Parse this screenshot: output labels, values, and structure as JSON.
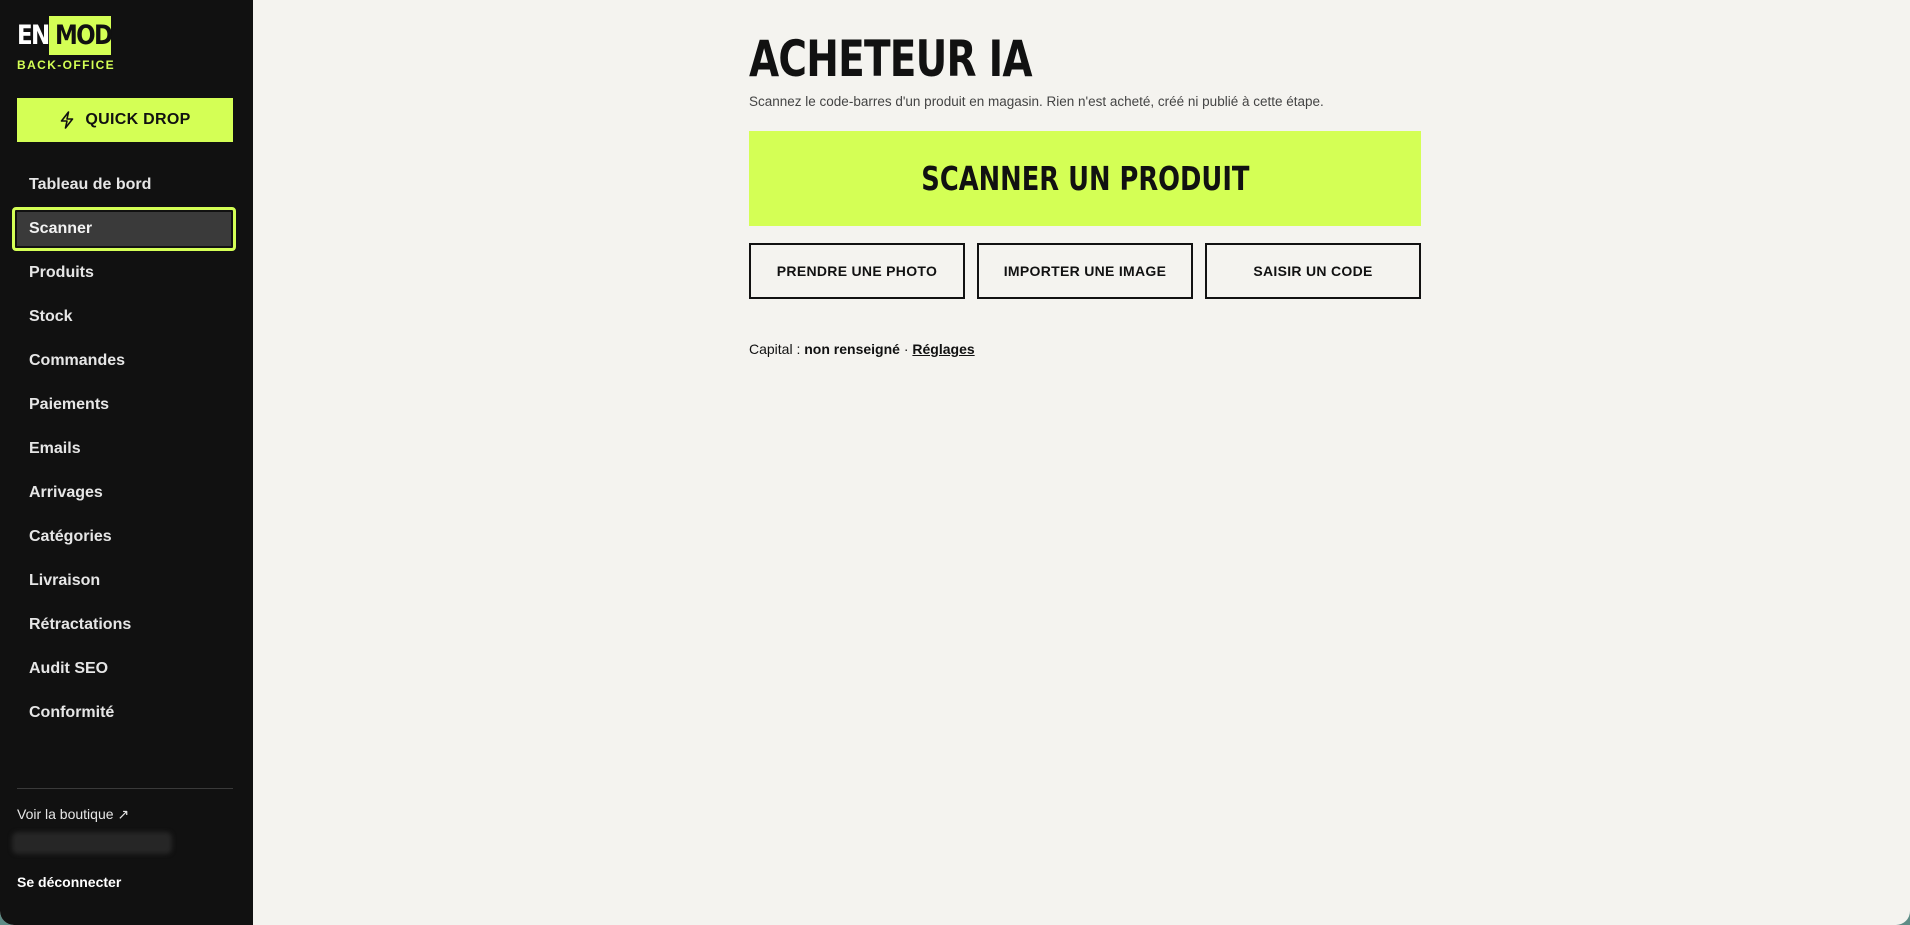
{
  "brand": {
    "logo_left": "EN",
    "logo_right": "MOD",
    "subtitle": "BACK-OFFICE",
    "accent_color": "#d4ff55"
  },
  "sidebar": {
    "quick_drop": {
      "label": "QUICK DROP",
      "icon": "bolt-icon"
    },
    "items": [
      {
        "label": "Tableau de bord",
        "active": false
      },
      {
        "label": "Scanner",
        "active": true
      },
      {
        "label": "Produits",
        "active": false
      },
      {
        "label": "Stock",
        "active": false
      },
      {
        "label": "Commandes",
        "active": false
      },
      {
        "label": "Paiements",
        "active": false
      },
      {
        "label": "Emails",
        "active": false
      },
      {
        "label": "Arrivages",
        "active": false
      },
      {
        "label": "Catégories",
        "active": false
      },
      {
        "label": "Livraison",
        "active": false
      },
      {
        "label": "Rétractations",
        "active": false
      },
      {
        "label": "Audit SEO",
        "active": false
      },
      {
        "label": "Conformité",
        "active": false
      }
    ],
    "view_shop": "Voir la boutique ↗",
    "logout": "Se déconnecter"
  },
  "main": {
    "title": "ACHETEUR IA",
    "subtitle": "Scannez le code-barres d'un produit en magasin. Rien n'est acheté, créé ni publié à cette étape.",
    "scan_button": "SCANNER UN PRODUIT",
    "actions": [
      {
        "label": "PRENDRE UNE PHOTO"
      },
      {
        "label": "IMPORTER UNE IMAGE"
      },
      {
        "label": "SAISIR UN CODE"
      }
    ],
    "capital": {
      "label": "Capital :",
      "value": "non renseigné",
      "separator": "·",
      "settings_link": "Réglages"
    }
  }
}
